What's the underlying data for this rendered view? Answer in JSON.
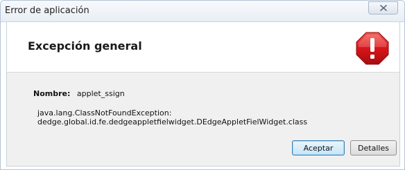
{
  "window": {
    "title": "Error de aplicación",
    "close_icon": "close-icon"
  },
  "header": {
    "title": "Excepción general",
    "icon": "error-stop-icon",
    "icon_color": "#d9141b"
  },
  "details": {
    "name_label": "Nombre:",
    "name_value": "applet_ssign",
    "exception_line1": "java.lang.ClassNotFoundException:",
    "exception_line2": "dedge.global.id.fe.dedgeappletfielwidget.DEdgeAppletFielWidget.class"
  },
  "buttons": {
    "accept_label": "Aceptar",
    "details_label": "Detalles"
  }
}
